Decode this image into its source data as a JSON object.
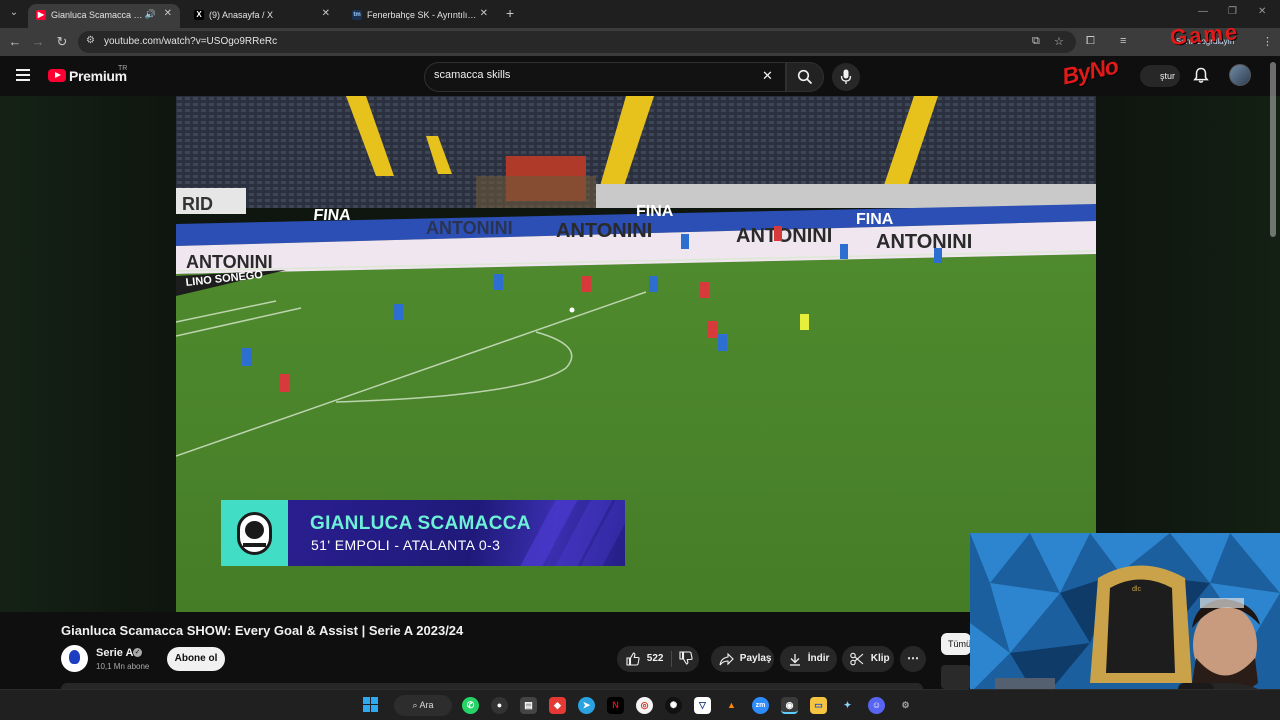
{
  "browser": {
    "tabs": [
      {
        "title": "Gianluca Scamacca SHOW: Every Goal & Assist | Serie A 2023/24",
        "favicon": "youtube-icon",
        "active": true,
        "audio": true
      },
      {
        "title": "(9) Anasayfa / X",
        "favicon": "x-icon",
        "active": false
      },
      {
        "title": "Fenerbahçe SK - Ayrıntılı kadro",
        "favicon": "transfermarkt-icon",
        "active": false
      }
    ],
    "url": "youtube.com/watch?v=USOgo9RReRc"
  },
  "youtube": {
    "brand": "Premium",
    "region": "TR",
    "search_value": "scamacca skills",
    "create_label": "Oluştur",
    "create_visible": "ştur",
    "notification_hint": "Şunu doğrulayın"
  },
  "watermark": {
    "line1": "ByNo",
    "line2": "Game"
  },
  "video": {
    "hoardings": [
      "RID",
      "FINA",
      "ANTONINI",
      "LINO SONEGO"
    ],
    "lower_third": {
      "crest_year": "1907",
      "crest_name": "ATALANTA",
      "player_name": "GIANLUCA SCAMACCA",
      "info": "51' EMPOLI - ATALANTA 0-3"
    }
  },
  "meta": {
    "title": "Gianluca Scamacca SHOW: Every Goal & Assist | Serie A 2023/24",
    "channel": "Serie A",
    "subscribers": "10,1 Mn abone",
    "subscribe_label": "Abone ol",
    "like_count": "522",
    "share_label": "Paylaş",
    "download_label": "İndir",
    "clip_label": "Klip",
    "chip_all": "Tümü"
  },
  "taskbar": {
    "search_label": "Ara"
  },
  "colors": {
    "youtube_red": "#ff0033",
    "lower_third_teal": "#42ddc5",
    "lower_third_purple": "#2a1e8f",
    "player_name_color": "#6df1d6"
  }
}
